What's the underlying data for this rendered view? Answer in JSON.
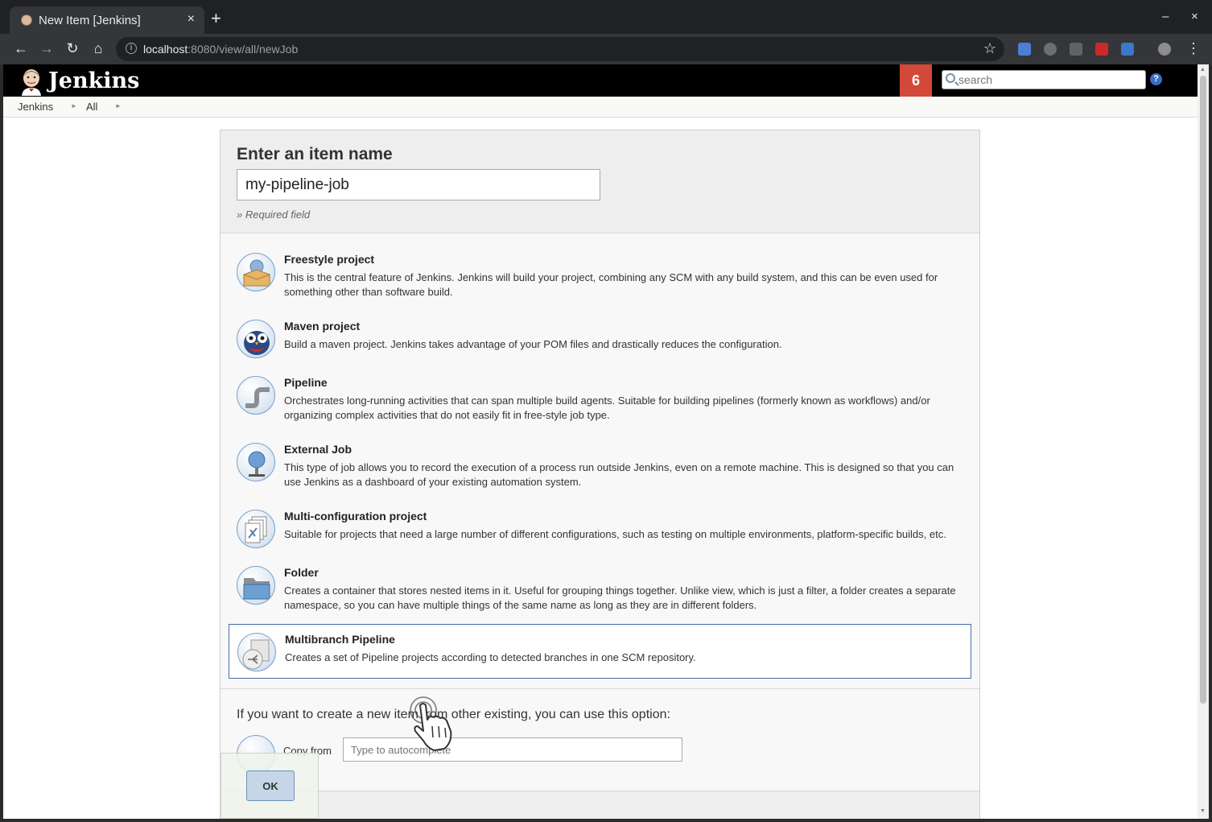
{
  "browser": {
    "tab_title": "New Item [Jenkins]",
    "url_host": "localhost",
    "url_path": ":8080/view/all/newJob",
    "new_tab_label": "+",
    "close_tab_label": "×",
    "window_minimize": "–",
    "window_close": "×"
  },
  "header": {
    "title": "Jenkins",
    "notification_count": "6",
    "search_placeholder": "search",
    "help_label": "?"
  },
  "breadcrumb": {
    "items": [
      "Jenkins",
      "All"
    ]
  },
  "form": {
    "heading": "Enter an item name",
    "item_name_value": "my-pipeline-job",
    "required_note": "» Required field"
  },
  "item_types": [
    {
      "name": "Freestyle project",
      "description": "This is the central feature of Jenkins. Jenkins will build your project, combining any SCM with any build system, and this can be even used for something other than software build.",
      "icon": "freestyle-icon"
    },
    {
      "name": "Maven project",
      "description": "Build a maven project. Jenkins takes advantage of your POM files and drastically reduces the configuration.",
      "icon": "maven-icon"
    },
    {
      "name": "Pipeline",
      "description": "Orchestrates long-running activities that can span multiple build agents. Suitable for building pipelines (formerly known as workflows) and/or organizing complex activities that do not easily fit in free-style job type.",
      "icon": "pipeline-icon"
    },
    {
      "name": "External Job",
      "description": "This type of job allows you to record the execution of a process run outside Jenkins, even on a remote machine. This is designed so that you can use Jenkins as a dashboard of your existing automation system.",
      "icon": "external-job-icon"
    },
    {
      "name": "Multi-configuration project",
      "description": "Suitable for projects that need a large number of different configurations, such as testing on multiple environments, platform-specific builds, etc.",
      "icon": "multi-config-icon"
    },
    {
      "name": "Folder",
      "description": "Creates a container that stores nested items in it. Useful for grouping things together. Unlike view, which is just a filter, a folder creates a separate namespace, so you can have multiple things of the same name as long as they are in different folders.",
      "icon": "folder-icon"
    },
    {
      "name": "Multibranch Pipeline",
      "description": "Creates a set of Pipeline projects according to detected branches in one SCM repository.",
      "icon": "multibranch-pipeline-icon",
      "selected": true
    }
  ],
  "copy": {
    "intro": "If you want to create a new item from other existing, you can use this option:",
    "label": "Copy from",
    "placeholder": "Type to autocomplete"
  },
  "ok_button": "OK",
  "colors": {
    "jenkins_header": "#000000",
    "badge_red": "#d24939",
    "selected_border": "#4a6fa5"
  }
}
